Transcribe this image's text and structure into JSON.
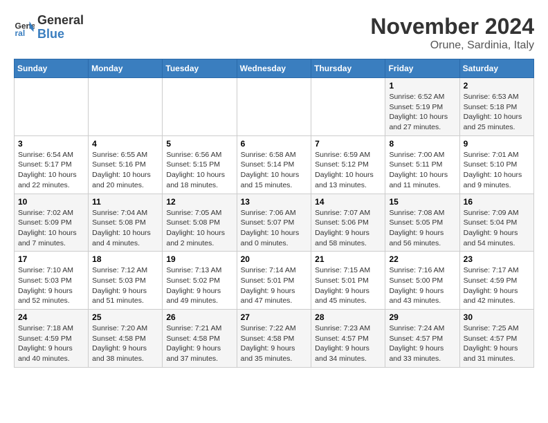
{
  "header": {
    "logo_line1": "General",
    "logo_line2": "Blue",
    "month": "November 2024",
    "location": "Orune, Sardinia, Italy"
  },
  "weekdays": [
    "Sunday",
    "Monday",
    "Tuesday",
    "Wednesday",
    "Thursday",
    "Friday",
    "Saturday"
  ],
  "weeks": [
    [
      {
        "day": "",
        "info": ""
      },
      {
        "day": "",
        "info": ""
      },
      {
        "day": "",
        "info": ""
      },
      {
        "day": "",
        "info": ""
      },
      {
        "day": "",
        "info": ""
      },
      {
        "day": "1",
        "info": "Sunrise: 6:52 AM\nSunset: 5:19 PM\nDaylight: 10 hours and 27 minutes."
      },
      {
        "day": "2",
        "info": "Sunrise: 6:53 AM\nSunset: 5:18 PM\nDaylight: 10 hours and 25 minutes."
      }
    ],
    [
      {
        "day": "3",
        "info": "Sunrise: 6:54 AM\nSunset: 5:17 PM\nDaylight: 10 hours and 22 minutes."
      },
      {
        "day": "4",
        "info": "Sunrise: 6:55 AM\nSunset: 5:16 PM\nDaylight: 10 hours and 20 minutes."
      },
      {
        "day": "5",
        "info": "Sunrise: 6:56 AM\nSunset: 5:15 PM\nDaylight: 10 hours and 18 minutes."
      },
      {
        "day": "6",
        "info": "Sunrise: 6:58 AM\nSunset: 5:14 PM\nDaylight: 10 hours and 15 minutes."
      },
      {
        "day": "7",
        "info": "Sunrise: 6:59 AM\nSunset: 5:12 PM\nDaylight: 10 hours and 13 minutes."
      },
      {
        "day": "8",
        "info": "Sunrise: 7:00 AM\nSunset: 5:11 PM\nDaylight: 10 hours and 11 minutes."
      },
      {
        "day": "9",
        "info": "Sunrise: 7:01 AM\nSunset: 5:10 PM\nDaylight: 10 hours and 9 minutes."
      }
    ],
    [
      {
        "day": "10",
        "info": "Sunrise: 7:02 AM\nSunset: 5:09 PM\nDaylight: 10 hours and 7 minutes."
      },
      {
        "day": "11",
        "info": "Sunrise: 7:04 AM\nSunset: 5:08 PM\nDaylight: 10 hours and 4 minutes."
      },
      {
        "day": "12",
        "info": "Sunrise: 7:05 AM\nSunset: 5:08 PM\nDaylight: 10 hours and 2 minutes."
      },
      {
        "day": "13",
        "info": "Sunrise: 7:06 AM\nSunset: 5:07 PM\nDaylight: 10 hours and 0 minutes."
      },
      {
        "day": "14",
        "info": "Sunrise: 7:07 AM\nSunset: 5:06 PM\nDaylight: 9 hours and 58 minutes."
      },
      {
        "day": "15",
        "info": "Sunrise: 7:08 AM\nSunset: 5:05 PM\nDaylight: 9 hours and 56 minutes."
      },
      {
        "day": "16",
        "info": "Sunrise: 7:09 AM\nSunset: 5:04 PM\nDaylight: 9 hours and 54 minutes."
      }
    ],
    [
      {
        "day": "17",
        "info": "Sunrise: 7:10 AM\nSunset: 5:03 PM\nDaylight: 9 hours and 52 minutes."
      },
      {
        "day": "18",
        "info": "Sunrise: 7:12 AM\nSunset: 5:03 PM\nDaylight: 9 hours and 51 minutes."
      },
      {
        "day": "19",
        "info": "Sunrise: 7:13 AM\nSunset: 5:02 PM\nDaylight: 9 hours and 49 minutes."
      },
      {
        "day": "20",
        "info": "Sunrise: 7:14 AM\nSunset: 5:01 PM\nDaylight: 9 hours and 47 minutes."
      },
      {
        "day": "21",
        "info": "Sunrise: 7:15 AM\nSunset: 5:01 PM\nDaylight: 9 hours and 45 minutes."
      },
      {
        "day": "22",
        "info": "Sunrise: 7:16 AM\nSunset: 5:00 PM\nDaylight: 9 hours and 43 minutes."
      },
      {
        "day": "23",
        "info": "Sunrise: 7:17 AM\nSunset: 4:59 PM\nDaylight: 9 hours and 42 minutes."
      }
    ],
    [
      {
        "day": "24",
        "info": "Sunrise: 7:18 AM\nSunset: 4:59 PM\nDaylight: 9 hours and 40 minutes."
      },
      {
        "day": "25",
        "info": "Sunrise: 7:20 AM\nSunset: 4:58 PM\nDaylight: 9 hours and 38 minutes."
      },
      {
        "day": "26",
        "info": "Sunrise: 7:21 AM\nSunset: 4:58 PM\nDaylight: 9 hours and 37 minutes."
      },
      {
        "day": "27",
        "info": "Sunrise: 7:22 AM\nSunset: 4:58 PM\nDaylight: 9 hours and 35 minutes."
      },
      {
        "day": "28",
        "info": "Sunrise: 7:23 AM\nSunset: 4:57 PM\nDaylight: 9 hours and 34 minutes."
      },
      {
        "day": "29",
        "info": "Sunrise: 7:24 AM\nSunset: 4:57 PM\nDaylight: 9 hours and 33 minutes."
      },
      {
        "day": "30",
        "info": "Sunrise: 7:25 AM\nSunset: 4:57 PM\nDaylight: 9 hours and 31 minutes."
      }
    ]
  ]
}
